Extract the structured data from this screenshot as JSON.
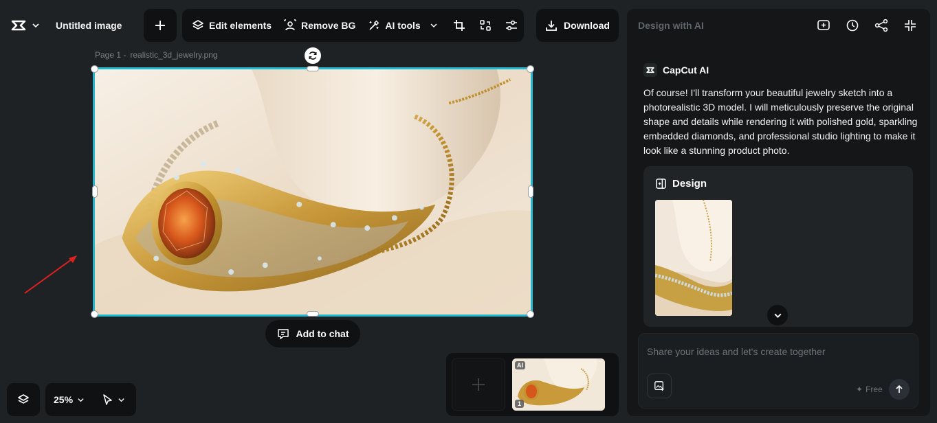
{
  "header": {
    "logo_icon": "capcut-logo-icon",
    "title": "Untitled image",
    "add_label": "+",
    "toolbar": {
      "edit_elements": "Edit elements",
      "remove_bg": "Remove BG",
      "ai_tools": "AI tools"
    },
    "download": "Download"
  },
  "canvas": {
    "page_label": "Page 1 -",
    "file_name": "realistic_3d_jewelry.png",
    "add_to_chat": "Add to chat"
  },
  "bottom": {
    "zoom": "25%",
    "page_number": "1",
    "ai_badge": "AI"
  },
  "panel": {
    "title": "Design with AI",
    "assistant_name": "CapCut AI",
    "message": "Of course! I'll transform your beautiful jewelry sketch into a photorealistic 3D model. I will meticulously preserve the original shape and details while rendering it with polished gold, sparkling embedded diamonds, and professional studio lighting to make it look like a stunning product photo.",
    "design_label": "Design",
    "input_placeholder": "Share your ideas and let's create together",
    "free_label": "Free"
  },
  "colors": {
    "accent_selection": "#22b8cf",
    "background": "#1f2224",
    "panel_bg": "#141617",
    "annotation_arrow": "#e02020"
  }
}
